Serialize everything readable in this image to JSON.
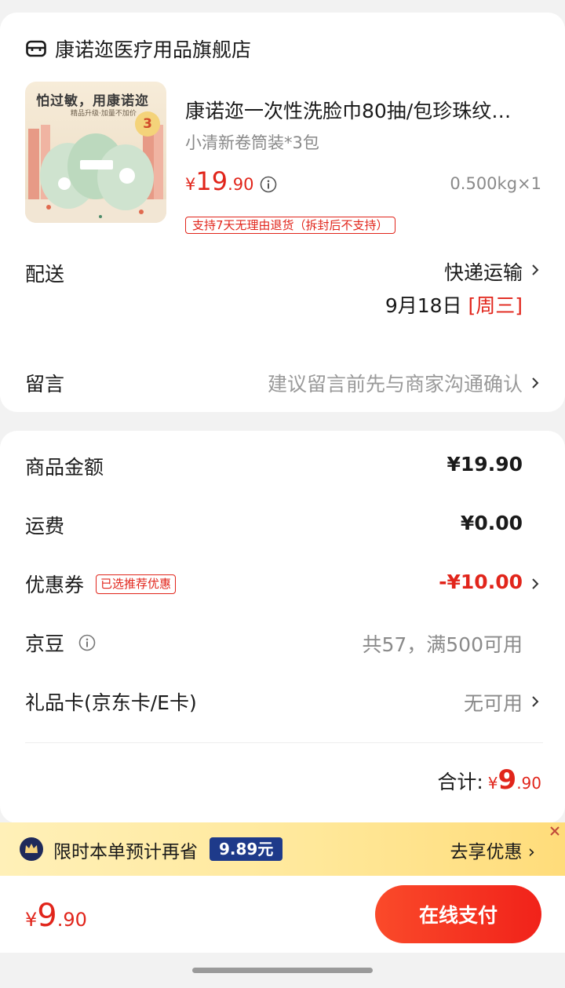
{
  "shop": {
    "name": "康诺迩医疗用品旗舰店",
    "icon": "shop-icon"
  },
  "product": {
    "thumb_title": "怕过敏，用康诺迩",
    "thumb_subtitle": "精品升级·加量不加价",
    "thumb_badge": "3",
    "title": "康诺迩一次性洗脸巾80抽/包珍珠纹…",
    "spec": "小清新卷筒装*3包",
    "price_symbol": "¥",
    "price_int": "19",
    "price_dec": ".90",
    "weight_qty": "0.500kg×1",
    "return_policy": "支持7天无理由退货（拆封后不支持）"
  },
  "delivery": {
    "label": "配送",
    "method": "快递运输",
    "date": "9月18日",
    "weekday": "[周三]"
  },
  "message": {
    "label": "留言",
    "hint": "建议留言前先与商家沟通确认"
  },
  "summary": {
    "goods_label": "商品金额",
    "goods_value": "¥19.90",
    "shipping_label": "运费",
    "shipping_value": "¥0.00",
    "coupon_label": "优惠券",
    "coupon_tag": "已选推荐优惠",
    "coupon_value": "-¥10.00",
    "jd_bean_label": "京豆",
    "jd_bean_value": "共57，满500可用",
    "gift_card_label": "礼品卡(京东卡/E卡)",
    "gift_card_value": "无可用",
    "total_label": "合计:",
    "total_symbol": "¥",
    "total_int": "9",
    "total_dec": ".90"
  },
  "promo": {
    "text": "限时本单预计再省",
    "badge": "9.89元",
    "action": "去享优惠"
  },
  "bottom": {
    "price_symbol": "¥",
    "price_int": "9",
    "price_dec": ".90",
    "pay_label": "在线支付"
  },
  "colors": {
    "accent": "#e1251b",
    "promo_badge": "#1e3a8a",
    "promo_bg": "#ffe89a"
  }
}
